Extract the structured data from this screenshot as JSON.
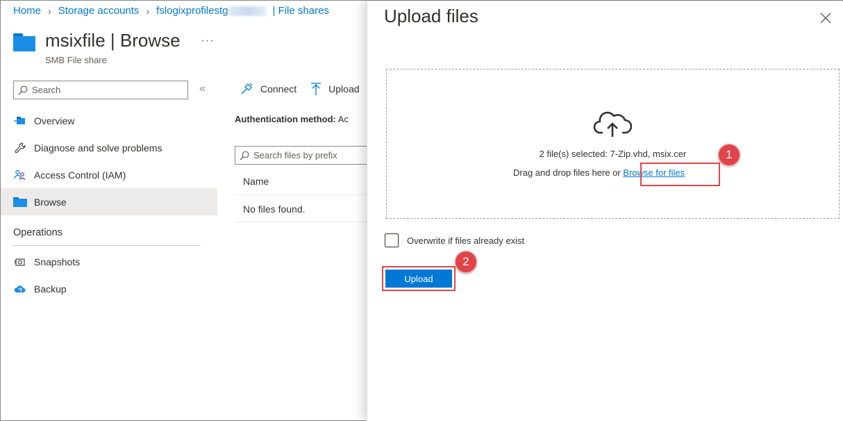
{
  "breadcrumb": {
    "home": "Home",
    "storage_accounts": "Storage accounts",
    "account": "fslogixprofilestg",
    "file_shares": "| File shares"
  },
  "header": {
    "title": "msixfile | Browse",
    "subtitle": "SMB File share",
    "more": "···"
  },
  "sidebar": {
    "search_placeholder": "Search",
    "collapse": "«",
    "items": [
      {
        "label": "Overview",
        "icon": "overview-icon"
      },
      {
        "label": "Diagnose and solve problems",
        "icon": "wrench-icon"
      },
      {
        "label": "Access Control (IAM)",
        "icon": "people-icon"
      },
      {
        "label": "Browse",
        "icon": "folder-icon",
        "active": true
      }
    ],
    "section": "Operations",
    "operations": [
      {
        "label": "Snapshots",
        "icon": "snapshot-icon"
      },
      {
        "label": "Backup",
        "icon": "cloud-backup-icon"
      }
    ]
  },
  "main": {
    "toolbar": {
      "connect": "Connect",
      "upload": "Upload"
    },
    "auth_label": "Authentication method:",
    "auth_value": "Ac",
    "search_placeholder": "Search files by prefix",
    "column_name": "Name",
    "empty_text": "No files found."
  },
  "panel": {
    "title": "Upload files",
    "selected_text": "2 file(s) selected: 7-Zip.vhd, msix.cer",
    "drag_text": "Drag and drop files here or",
    "browse_link": "Browse for files",
    "overwrite_label": "Overwrite if files already exist",
    "overwrite_checked": false,
    "upload_button": "Upload",
    "callout_1": "1",
    "callout_2": "2"
  },
  "colors": {
    "accent": "#0078d4",
    "highlight": "#e0444a",
    "active_nav": "#edebe9"
  }
}
